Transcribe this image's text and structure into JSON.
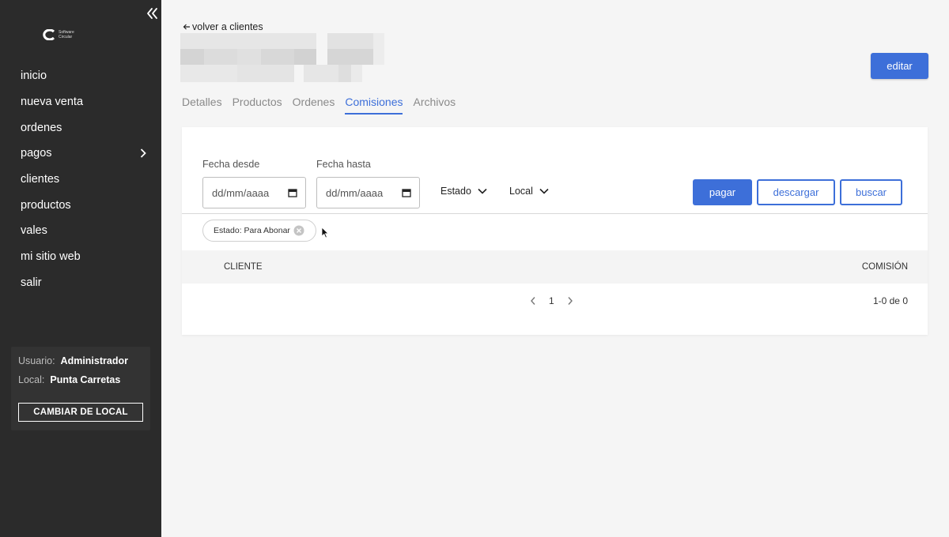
{
  "sidebar": {
    "logo_text": "Software Circular",
    "nav": [
      {
        "label": "inicio"
      },
      {
        "label": "nueva venta"
      },
      {
        "label": "ordenes"
      },
      {
        "label": "pagos",
        "has_submenu": true
      },
      {
        "label": "clientes"
      },
      {
        "label": "productos"
      },
      {
        "label": "vales"
      },
      {
        "label": "mi sitio web"
      },
      {
        "label": "salir"
      }
    ],
    "user": {
      "user_label": "Usuario:",
      "user_value": "Administrador",
      "local_label": "Local:",
      "local_value": "Punta Carretas",
      "change_button": "CAMBIAR DE LOCAL"
    }
  },
  "header": {
    "back_link": "volver a clientes",
    "edit_button": "editar"
  },
  "tabs": [
    {
      "label": "Detalles",
      "active": false
    },
    {
      "label": "Productos",
      "active": false
    },
    {
      "label": "Ordenes",
      "active": false
    },
    {
      "label": "Comisiones",
      "active": true
    },
    {
      "label": "Archivos",
      "active": false
    }
  ],
  "filters": {
    "date_from_label": "Fecha desde",
    "date_from_placeholder": "dd/mm/aaaa",
    "date_to_label": "Fecha hasta",
    "date_to_placeholder": "dd/mm/aaaa",
    "estado_label": "Estado",
    "local_label": "Local",
    "pay_button": "pagar",
    "download_button": "descargar",
    "search_button": "buscar",
    "active_chip": "Estado: Para Abonar"
  },
  "table": {
    "columns": [
      "CLIENTE",
      "COMISIÓN"
    ],
    "rows": []
  },
  "pagination": {
    "current_page": "1",
    "range_text": "1-0 de 0"
  },
  "colors": {
    "sidebar_bg": "#2b2b2b",
    "accent": "#3d6fd9",
    "page_bg": "#f5f5f5"
  }
}
